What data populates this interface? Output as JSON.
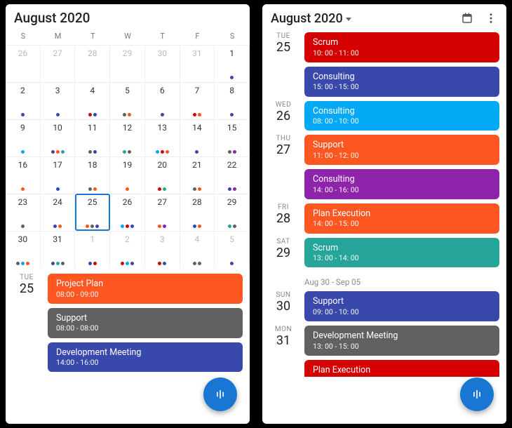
{
  "colors": {
    "orange": "#ff5722",
    "gray": "#616161",
    "indigo": "#3949ab",
    "red": "#d50000",
    "cyan": "#03a9f4",
    "purple": "#8e24aa",
    "green": "#26a69a"
  },
  "left": {
    "title": "August 2020",
    "dow": [
      "S",
      "M",
      "T",
      "W",
      "T",
      "F",
      "S"
    ],
    "selected_day": 25,
    "days": [
      {
        "n": 26,
        "other": true,
        "dots": []
      },
      {
        "n": 27,
        "other": true,
        "dots": []
      },
      {
        "n": 28,
        "other": true,
        "dots": []
      },
      {
        "n": 29,
        "other": true,
        "dots": []
      },
      {
        "n": 30,
        "other": true,
        "dots": []
      },
      {
        "n": 31,
        "other": true,
        "dots": []
      },
      {
        "n": 1,
        "dots": [
          "indigo"
        ]
      },
      {
        "n": 2,
        "dots": [
          "indigo"
        ]
      },
      {
        "n": 3,
        "dots": [
          "indigo"
        ]
      },
      {
        "n": 4,
        "dots": [
          "red",
          "indigo"
        ]
      },
      {
        "n": 5,
        "dots": [
          "gray",
          "orange"
        ]
      },
      {
        "n": 6,
        "dots": [
          "indigo"
        ]
      },
      {
        "n": 7,
        "dots": [
          "red",
          "orange"
        ]
      },
      {
        "n": 8,
        "dots": [
          "indigo"
        ]
      },
      {
        "n": 9,
        "dots": [
          "cyan"
        ]
      },
      {
        "n": 10,
        "dots": [
          "indigo",
          "orange",
          "green"
        ]
      },
      {
        "n": 11,
        "dots": [
          "gray",
          "indigo"
        ]
      },
      {
        "n": 12,
        "dots": [
          "green",
          "gray"
        ]
      },
      {
        "n": 13,
        "dots": [
          "cyan",
          "red",
          "orange"
        ]
      },
      {
        "n": 14,
        "dots": [
          "indigo"
        ]
      },
      {
        "n": 15,
        "dots": [
          "gray",
          "purple"
        ]
      },
      {
        "n": 16,
        "dots": [
          "orange"
        ]
      },
      {
        "n": 17,
        "dots": [
          "indigo"
        ]
      },
      {
        "n": 18,
        "dots": [
          "gray",
          "orange"
        ]
      },
      {
        "n": 19,
        "dots": [
          "orange"
        ]
      },
      {
        "n": 20,
        "dots": [
          "red",
          "green"
        ]
      },
      {
        "n": 21,
        "dots": [
          "gray",
          "orange"
        ]
      },
      {
        "n": 22,
        "dots": [
          "indigo",
          "purple"
        ]
      },
      {
        "n": 23,
        "dots": [
          "gray"
        ]
      },
      {
        "n": 24,
        "dots": [
          "indigo",
          "orange"
        ]
      },
      {
        "n": 25,
        "dots": [
          "orange",
          "gray",
          "indigo"
        ]
      },
      {
        "n": 26,
        "dots": [
          "cyan",
          "red",
          "indigo"
        ]
      },
      {
        "n": 27,
        "dots": [
          "orange",
          "purple"
        ]
      },
      {
        "n": 28,
        "dots": [
          "indigo",
          "orange"
        ]
      },
      {
        "n": 29,
        "dots": [
          "green",
          "gray"
        ]
      },
      {
        "n": 30,
        "dots": [
          "gray",
          "cyan",
          "orange"
        ]
      },
      {
        "n": 31,
        "dots": [
          "indigo",
          "green",
          "gray"
        ]
      },
      {
        "n": 1,
        "other": true,
        "dots": [
          "indigo",
          "red"
        ]
      },
      {
        "n": 2,
        "other": true,
        "dots": [
          "red",
          "cyan",
          "indigo"
        ]
      },
      {
        "n": 3,
        "other": true,
        "dots": [
          "red",
          "indigo"
        ]
      },
      {
        "n": 4,
        "other": true,
        "dots": [
          "gray",
          "gray"
        ]
      },
      {
        "n": 5,
        "other": true,
        "dots": [
          "indigo"
        ]
      }
    ],
    "agenda": [
      {
        "wd": "TUE",
        "dn": "25",
        "events": [
          {
            "title": "Project Plan",
            "time": "08:00 - 09:00",
            "color": "orange"
          },
          {
            "title": "Support",
            "time": "08:00 - 08:00",
            "color": "gray"
          },
          {
            "title": "Development Meeting",
            "time": "14:00 - 16:00",
            "color": "indigo"
          }
        ]
      }
    ]
  },
  "right": {
    "title": "August 2020",
    "range_separator": "Aug 30 - Sep 05",
    "agenda": [
      {
        "wd": "TUE",
        "dn": "25",
        "events": [
          {
            "title": "Scrum",
            "time": "10: 00 - 11: 00",
            "color": "red"
          },
          {
            "title": "Consulting",
            "time": "15: 00 - 15: 00",
            "color": "indigo"
          }
        ]
      },
      {
        "wd": "WED",
        "dn": "26",
        "events": [
          {
            "title": "Consulting",
            "time": "08: 00 - 10: 00",
            "color": "cyan"
          }
        ]
      },
      {
        "wd": "THU",
        "dn": "27",
        "events": [
          {
            "title": "Support",
            "time": "11: 00 - 12: 00",
            "color": "orange"
          },
          {
            "title": "Consulting",
            "time": "14: 00 - 16: 00",
            "color": "purple"
          }
        ]
      },
      {
        "wd": "FRI",
        "dn": "28",
        "events": [
          {
            "title": "Plan Execution",
            "time": "14: 00 - 15: 00",
            "color": "orange"
          }
        ]
      },
      {
        "wd": "SAT",
        "dn": "29",
        "events": [
          {
            "title": "Scrum",
            "time": "13: 00 - 14: 00",
            "color": "green"
          }
        ]
      },
      {
        "separator": true
      },
      {
        "wd": "SUN",
        "dn": "30",
        "events": [
          {
            "title": "Support",
            "time": "09: 00 - 10: 00",
            "color": "indigo"
          }
        ]
      },
      {
        "wd": "MON",
        "dn": "31",
        "events": [
          {
            "title": "Development Meeting",
            "time": "13: 00 - 15: 00",
            "color": "gray"
          },
          {
            "title": "Plan Execution",
            "time": "",
            "color": "red",
            "cut": true
          }
        ]
      }
    ]
  }
}
